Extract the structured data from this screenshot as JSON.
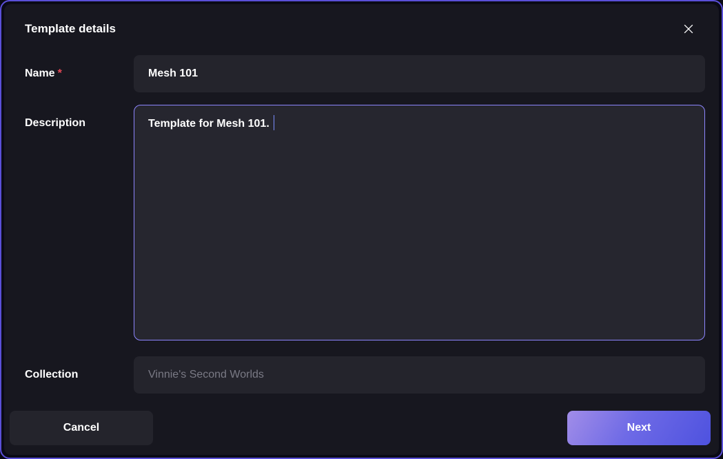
{
  "dialog": {
    "title": "Template details",
    "fields": {
      "name": {
        "label": "Name",
        "required_mark": "*",
        "value": "Mesh 101"
      },
      "description": {
        "label": "Description",
        "value": "Template for Mesh 101."
      },
      "collection": {
        "label": "Collection",
        "placeholder": "Vinnie's Second Worlds"
      }
    },
    "buttons": {
      "cancel": "Cancel",
      "next": "Next"
    }
  }
}
